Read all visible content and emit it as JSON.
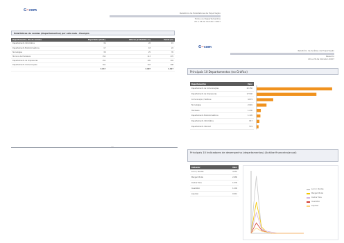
{
  "page1": {
    "header": [
      "Relatório de Estatísticas de Exportação",
      "Todos os Departamentos",
      "20 a 26 de Outubro 2007"
    ],
    "section_title": "Estatísticas de vendas (Departamentos) por esta sala - Exemplo",
    "table": {
      "columns": [
        "Departamento / Dia da semana",
        "Exportados (Unid.)",
        "Valores produzidos (%)",
        "Venda (m)"
      ],
      "rows": [
        [
          "Departamento Informática",
          "36",
          "28",
          "15"
        ],
        [
          "Departamento Eletrodomésticos",
          "17",
          "18",
          "22"
        ],
        [
          "Tecnologias",
          "38",
          "25",
          "35"
        ],
        [
          "Técnicos de Hardware",
          "154",
          "113",
          "170"
        ],
        [
          "Departamento de Impressoras",
          "152",
          "105",
          "104"
        ],
        [
          "Departamento Comunicações",
          "161",
          "144",
          "198"
        ]
      ],
      "total": [
        "",
        "4.817",
        "3.007",
        "4.827"
      ]
    }
  },
  "page2": {
    "header": [
      "Relatório de Análise de Exportação",
      "Resumo",
      "20 a 26 de Outubro 2007"
    ],
    "section1_title": "Principais 10 Departamentos (no Gráfico)",
    "table1": {
      "columns": [
        "Departamentos",
        "Valor"
      ],
      "rows": [
        [
          "Departamento de Comunicações",
          "22.150"
        ],
        [
          "Departamento de Impressoras",
          "17.540"
        ],
        [
          "Comunicação / Telefone",
          "4.874"
        ],
        [
          "Tecnologias",
          "2.901"
        ],
        [
          "Hardware",
          "1.230"
        ],
        [
          "Departamento Eletrodomésticos",
          "1.105"
        ],
        [
          "Departamento Informática",
          "817"
        ],
        [
          "Departamento Internet",
          "574"
        ]
      ]
    },
    "section2_title": "Principais 10 Indicadores de desempenho (departamentos) (Análise financeira/anual)",
    "table2": {
      "columns": [
        "Indicador",
        "Valor"
      ],
      "rows": [
        [
          "Lucro / Vendas",
          "4.251"
        ],
        [
          "Margem Bruta",
          "2.980"
        ],
        [
          "Custos Fixos",
          "1.530"
        ],
        [
          "Inventário",
          "1.144"
        ],
        [
          "Liquidez",
          "0.912"
        ]
      ]
    },
    "legend": [
      {
        "label": "Lucro / Vendas",
        "color": "#c9c9c9"
      },
      {
        "label": "Margem Bruta",
        "color": "#f2c500"
      },
      {
        "label": "Custos Fixos",
        "color": "#d4b4e0"
      },
      {
        "label": "Inventário",
        "color": "#d23a2e"
      },
      {
        "label": "Liquidez",
        "color": "#ffd27a"
      }
    ]
  },
  "colors": {
    "bar": "#f0921e",
    "table_header": "#5b5b5b",
    "panel_bg": "#eef0f5"
  },
  "chart_data": [
    {
      "type": "bar",
      "orientation": "horizontal",
      "categories": [
        "Departamento de Comunicações",
        "Departamento de Impressoras",
        "Comunicação / Telefone",
        "Tecnologias",
        "Hardware",
        "Departamento Eletrodomésticos",
        "Departamento Informática",
        "Departamento Internet"
      ],
      "values": [
        22150,
        17540,
        4874,
        2901,
        1230,
        1105,
        817,
        574
      ],
      "xlim": [
        0,
        24000
      ],
      "grid": false
    },
    {
      "type": "line",
      "x": [
        0,
        1,
        2,
        3,
        4,
        5,
        6,
        7,
        8,
        9,
        10
      ],
      "series": [
        {
          "name": "Lucro / Vendas",
          "values": [
            0,
            55,
            2,
            1,
            0,
            0,
            0,
            0,
            0,
            0,
            0
          ]
        },
        {
          "name": "Margem Bruta",
          "values": [
            0,
            30,
            6,
            1,
            0,
            0,
            0,
            0,
            0,
            0,
            0
          ]
        },
        {
          "name": "Custos Fixos",
          "values": [
            0,
            20,
            4,
            2,
            1,
            0,
            0,
            0,
            0,
            0,
            0
          ]
        },
        {
          "name": "Inventário",
          "values": [
            0,
            10,
            3,
            1,
            0,
            0,
            0,
            0,
            0,
            0,
            0
          ]
        },
        {
          "name": "Liquidez",
          "values": [
            0,
            5,
            2,
            1,
            0,
            0,
            0,
            0,
            0,
            0,
            0
          ]
        }
      ],
      "ylim": [
        0,
        60
      ],
      "legend_position": "right"
    }
  ]
}
